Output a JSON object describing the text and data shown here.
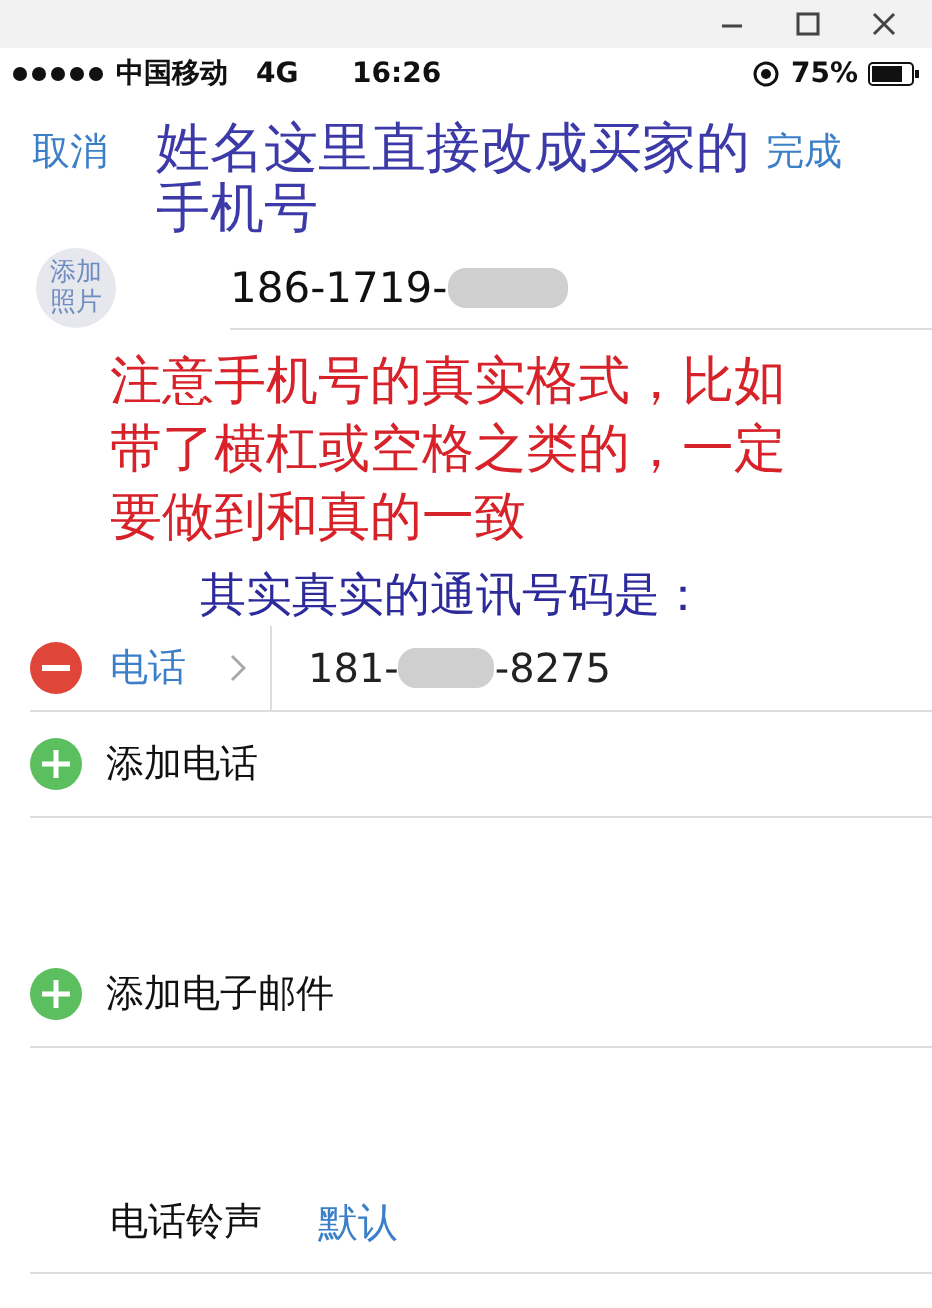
{
  "status_bar": {
    "carrier": "中国移动",
    "network": "4G",
    "time": "16:26",
    "battery": "75%"
  },
  "nav": {
    "cancel": "取消",
    "title_note": "姓名这里直接改成买家的手机号",
    "done": "完成"
  },
  "photo_button": "添加照片",
  "name_field": {
    "value": "186-1719-",
    "redacted": true
  },
  "format_note": "注意手机号的真实格式，比如带了横杠或空格之类的，一定要做到和真的一致",
  "real_note": "其实真实的通讯号码是：",
  "phone": {
    "label": "电话",
    "value_start": "181-",
    "redacted": true,
    "value_end": "-8275"
  },
  "add_rows": [
    {
      "kind": "add",
      "label": "添加电话"
    },
    {
      "kind": "add",
      "label": "添加电子邮件"
    }
  ],
  "ringtone": {
    "label": "电话铃声",
    "value": "默认"
  }
}
